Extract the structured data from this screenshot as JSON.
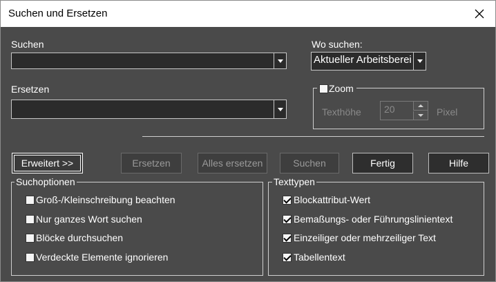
{
  "window": {
    "title": "Suchen und Ersetzen"
  },
  "search": {
    "label": "Suchen",
    "value": ""
  },
  "where": {
    "label": "Wo suchen:",
    "value": "Aktueller Arbeitsbereich"
  },
  "replace": {
    "label": "Ersetzen",
    "value": ""
  },
  "zoom": {
    "label": "Zoom",
    "checked": false,
    "height_label": "Texthöhe",
    "height_value": "20",
    "unit": "Pixel"
  },
  "buttons": {
    "advanced": "Erweitert >>",
    "replace": "Ersetzen",
    "replace_all": "Alles ersetzen",
    "find": "Suchen",
    "done": "Fertig",
    "help": "Hilfe"
  },
  "search_options": {
    "title": "Suchoptionen",
    "items": [
      {
        "label": "Groß-/Kleinschreibung beachten",
        "checked": false
      },
      {
        "label": "Nur ganzes Wort suchen",
        "checked": false
      },
      {
        "label": "Blöcke durchsuchen",
        "checked": false
      },
      {
        "label": "Verdeckte Elemente ignorieren",
        "checked": false
      }
    ]
  },
  "text_types": {
    "title": "Texttypen",
    "items": [
      {
        "label": "Blockattribut-Wert",
        "checked": true
      },
      {
        "label": "Bemaßungs- oder Führungslinientext",
        "checked": true
      },
      {
        "label": "Einzeiliger oder mehrzeiliger Text",
        "checked": true
      },
      {
        "label": "Tabellentext",
        "checked": true
      }
    ]
  }
}
